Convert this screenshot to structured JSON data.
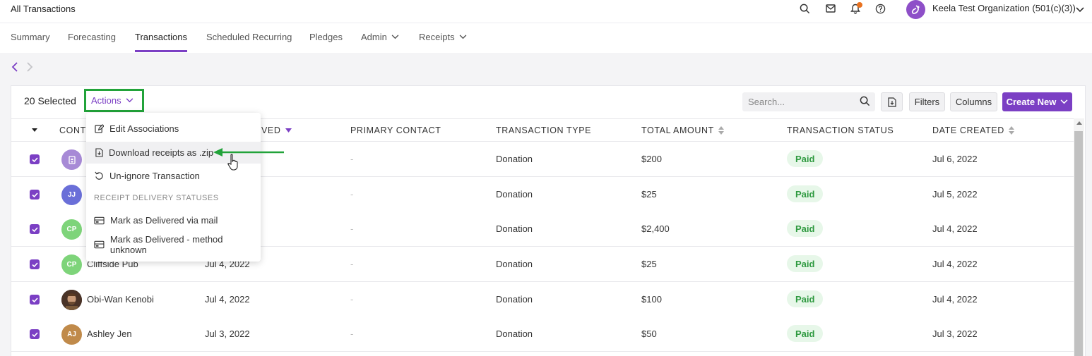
{
  "header": {
    "title": "All Transactions",
    "org_name": "Keela Test Organization (501(c)(3))"
  },
  "tabs": [
    {
      "label": "Summary"
    },
    {
      "label": "Forecasting"
    },
    {
      "label": "Transactions",
      "active": true
    },
    {
      "label": "Scheduled Recurring"
    },
    {
      "label": "Pledges"
    },
    {
      "label": "Admin",
      "dropdown": true
    },
    {
      "label": "Receipts",
      "dropdown": true
    }
  ],
  "toolbar": {
    "selected_label": "20 Selected",
    "actions_label": "Actions",
    "search_placeholder": "Search...",
    "filters_label": "Filters",
    "columns_label": "Columns",
    "create_new_label": "Create New"
  },
  "columns": {
    "contact": "CONT",
    "date_received": "VED",
    "primary_contact": "PRIMARY CONTACT",
    "transaction_type": "TRANSACTION TYPE",
    "total_amount": "TOTAL AMOUNT",
    "transaction_status": "TRANSACTION STATUS",
    "date_created": "DATE CREATED"
  },
  "rows": [
    {
      "initials": "",
      "contact": "",
      "date": "",
      "primary": "-",
      "type": "Donation",
      "amount": "$200",
      "status": "Paid",
      "created": "Jul 6, 2022"
    },
    {
      "initials": "JJ",
      "contact": "",
      "date": "",
      "primary": "-",
      "type": "Donation",
      "amount": "$25",
      "status": "Paid",
      "created": "Jul 5, 2022"
    },
    {
      "initials": "CP",
      "contact": "",
      "date": "",
      "primary": "-",
      "type": "Donation",
      "amount": "$2,400",
      "status": "Paid",
      "created": "Jul 4, 2022"
    },
    {
      "initials": "CP",
      "contact": "Cliffside Pub",
      "date": "Jul 4, 2022",
      "primary": "-",
      "type": "Donation",
      "amount": "$25",
      "status": "Paid",
      "created": "Jul 4, 2022"
    },
    {
      "initials": "",
      "contact": "Obi-Wan Kenobi",
      "date": "Jul 4, 2022",
      "primary": "-",
      "type": "Donation",
      "amount": "$100",
      "status": "Paid",
      "created": "Jul 4, 2022"
    },
    {
      "initials": "AJ",
      "contact": "Ashley Jen",
      "date": "Jul 3, 2022",
      "primary": "-",
      "type": "Donation",
      "amount": "$50",
      "status": "Paid",
      "created": "Jul 3, 2022"
    }
  ],
  "actions_menu": {
    "edit_associations": "Edit Associations",
    "download_receipts": "Download receipts as .zip",
    "unignore": "Un-ignore Transaction",
    "section_label": "RECEIPT DELIVERY STATUSES",
    "mark_mail": "Mark as Delivered via mail",
    "mark_unknown": "Mark as Delivered - method unknown"
  },
  "colors": {
    "accent": "#7b3fc4",
    "highlight": "#22a33a",
    "paid_bg": "#e7f7e9",
    "paid_text": "#2f9a40",
    "notification": "#e8711f"
  },
  "icons": [
    "search-icon",
    "mail-icon",
    "bell-icon",
    "help-icon",
    "chevron-down-icon",
    "chevron-left-icon",
    "chevron-right-icon",
    "export-icon",
    "edit-icon",
    "download-icon",
    "undo-icon",
    "mail-delivered-icon",
    "sort-icon",
    "check-icon"
  ]
}
